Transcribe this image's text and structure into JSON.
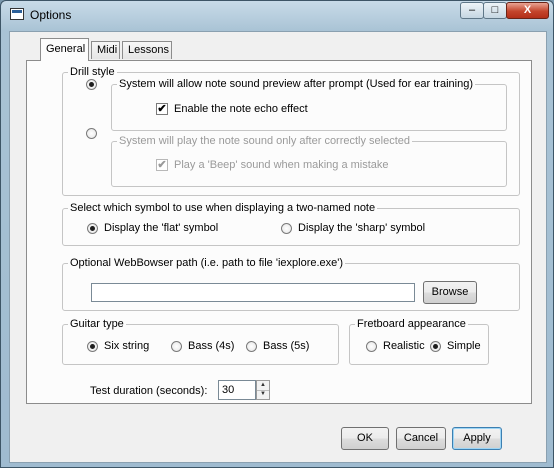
{
  "window": {
    "title": "Options",
    "min_glyph": "–",
    "max_glyph": "□",
    "close_glyph": "X"
  },
  "tabs": [
    {
      "label": "General"
    },
    {
      "label": "Midi"
    },
    {
      "label": "Lessons"
    }
  ],
  "drill_style": {
    "legend": "Drill style",
    "option1": {
      "legend": "System will allow note sound preview after prompt (Used for ear training)",
      "checkbox_label": "Enable the note echo effect",
      "checkbox_checked": true,
      "selected": true
    },
    "option2": {
      "legend": "System will play the note sound only after correctly selected",
      "checkbox_label": "Play a 'Beep' sound when making a mistake",
      "checkbox_checked": true,
      "selected": false
    }
  },
  "symbol": {
    "legend": "Select which symbol to use when displaying a two-named note",
    "options": [
      {
        "label": "Display the 'flat' symbol",
        "selected": true
      },
      {
        "label": "Display the 'sharp' symbol",
        "selected": false
      }
    ]
  },
  "browser": {
    "legend": "Optional WebBowser path (i.e. path to file 'iexplore.exe')",
    "path_value": "",
    "browse_label": "Browse"
  },
  "guitar_type": {
    "legend": "Guitar type",
    "options": [
      {
        "label": "Six string",
        "selected": true
      },
      {
        "label": "Bass (4s)",
        "selected": false
      },
      {
        "label": "Bass (5s)",
        "selected": false
      }
    ]
  },
  "fretboard": {
    "legend": "Fretboard appearance",
    "options": [
      {
        "label": "Realistic",
        "selected": false
      },
      {
        "label": "Simple",
        "selected": true
      }
    ]
  },
  "test_duration": {
    "label": "Test duration (seconds):",
    "value": "30"
  },
  "buttons": {
    "ok": "OK",
    "cancel": "Cancel",
    "apply": "Apply"
  },
  "check_glyph": "✔"
}
